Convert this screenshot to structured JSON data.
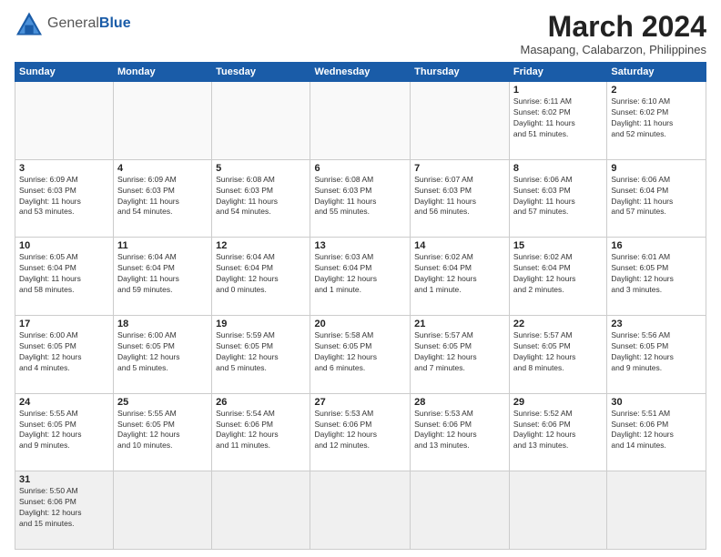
{
  "header": {
    "logo_general": "General",
    "logo_blue": "Blue",
    "month_title": "March 2024",
    "subtitle": "Masapang, Calabarzon, Philippines"
  },
  "weekdays": [
    "Sunday",
    "Monday",
    "Tuesday",
    "Wednesday",
    "Thursday",
    "Friday",
    "Saturday"
  ],
  "weeks": [
    [
      {
        "day": "",
        "info": ""
      },
      {
        "day": "",
        "info": ""
      },
      {
        "day": "",
        "info": ""
      },
      {
        "day": "",
        "info": ""
      },
      {
        "day": "",
        "info": ""
      },
      {
        "day": "1",
        "info": "Sunrise: 6:11 AM\nSunset: 6:02 PM\nDaylight: 11 hours\nand 51 minutes."
      },
      {
        "day": "2",
        "info": "Sunrise: 6:10 AM\nSunset: 6:02 PM\nDaylight: 11 hours\nand 52 minutes."
      }
    ],
    [
      {
        "day": "3",
        "info": "Sunrise: 6:09 AM\nSunset: 6:03 PM\nDaylight: 11 hours\nand 53 minutes."
      },
      {
        "day": "4",
        "info": "Sunrise: 6:09 AM\nSunset: 6:03 PM\nDaylight: 11 hours\nand 54 minutes."
      },
      {
        "day": "5",
        "info": "Sunrise: 6:08 AM\nSunset: 6:03 PM\nDaylight: 11 hours\nand 54 minutes."
      },
      {
        "day": "6",
        "info": "Sunrise: 6:08 AM\nSunset: 6:03 PM\nDaylight: 11 hours\nand 55 minutes."
      },
      {
        "day": "7",
        "info": "Sunrise: 6:07 AM\nSunset: 6:03 PM\nDaylight: 11 hours\nand 56 minutes."
      },
      {
        "day": "8",
        "info": "Sunrise: 6:06 AM\nSunset: 6:03 PM\nDaylight: 11 hours\nand 57 minutes."
      },
      {
        "day": "9",
        "info": "Sunrise: 6:06 AM\nSunset: 6:04 PM\nDaylight: 11 hours\nand 57 minutes."
      }
    ],
    [
      {
        "day": "10",
        "info": "Sunrise: 6:05 AM\nSunset: 6:04 PM\nDaylight: 11 hours\nand 58 minutes."
      },
      {
        "day": "11",
        "info": "Sunrise: 6:04 AM\nSunset: 6:04 PM\nDaylight: 11 hours\nand 59 minutes."
      },
      {
        "day": "12",
        "info": "Sunrise: 6:04 AM\nSunset: 6:04 PM\nDaylight: 12 hours\nand 0 minutes."
      },
      {
        "day": "13",
        "info": "Sunrise: 6:03 AM\nSunset: 6:04 PM\nDaylight: 12 hours\nand 1 minute."
      },
      {
        "day": "14",
        "info": "Sunrise: 6:02 AM\nSunset: 6:04 PM\nDaylight: 12 hours\nand 1 minute."
      },
      {
        "day": "15",
        "info": "Sunrise: 6:02 AM\nSunset: 6:04 PM\nDaylight: 12 hours\nand 2 minutes."
      },
      {
        "day": "16",
        "info": "Sunrise: 6:01 AM\nSunset: 6:05 PM\nDaylight: 12 hours\nand 3 minutes."
      }
    ],
    [
      {
        "day": "17",
        "info": "Sunrise: 6:00 AM\nSunset: 6:05 PM\nDaylight: 12 hours\nand 4 minutes."
      },
      {
        "day": "18",
        "info": "Sunrise: 6:00 AM\nSunset: 6:05 PM\nDaylight: 12 hours\nand 5 minutes."
      },
      {
        "day": "19",
        "info": "Sunrise: 5:59 AM\nSunset: 6:05 PM\nDaylight: 12 hours\nand 5 minutes."
      },
      {
        "day": "20",
        "info": "Sunrise: 5:58 AM\nSunset: 6:05 PM\nDaylight: 12 hours\nand 6 minutes."
      },
      {
        "day": "21",
        "info": "Sunrise: 5:57 AM\nSunset: 6:05 PM\nDaylight: 12 hours\nand 7 minutes."
      },
      {
        "day": "22",
        "info": "Sunrise: 5:57 AM\nSunset: 6:05 PM\nDaylight: 12 hours\nand 8 minutes."
      },
      {
        "day": "23",
        "info": "Sunrise: 5:56 AM\nSunset: 6:05 PM\nDaylight: 12 hours\nand 9 minutes."
      }
    ],
    [
      {
        "day": "24",
        "info": "Sunrise: 5:55 AM\nSunset: 6:05 PM\nDaylight: 12 hours\nand 9 minutes."
      },
      {
        "day": "25",
        "info": "Sunrise: 5:55 AM\nSunset: 6:05 PM\nDaylight: 12 hours\nand 10 minutes."
      },
      {
        "day": "26",
        "info": "Sunrise: 5:54 AM\nSunset: 6:06 PM\nDaylight: 12 hours\nand 11 minutes."
      },
      {
        "day": "27",
        "info": "Sunrise: 5:53 AM\nSunset: 6:06 PM\nDaylight: 12 hours\nand 12 minutes."
      },
      {
        "day": "28",
        "info": "Sunrise: 5:53 AM\nSunset: 6:06 PM\nDaylight: 12 hours\nand 13 minutes."
      },
      {
        "day": "29",
        "info": "Sunrise: 5:52 AM\nSunset: 6:06 PM\nDaylight: 12 hours\nand 13 minutes."
      },
      {
        "day": "30",
        "info": "Sunrise: 5:51 AM\nSunset: 6:06 PM\nDaylight: 12 hours\nand 14 minutes."
      }
    ],
    [
      {
        "day": "31",
        "info": "Sunrise: 5:50 AM\nSunset: 6:06 PM\nDaylight: 12 hours\nand 15 minutes."
      },
      {
        "day": "",
        "info": ""
      },
      {
        "day": "",
        "info": ""
      },
      {
        "day": "",
        "info": ""
      },
      {
        "day": "",
        "info": ""
      },
      {
        "day": "",
        "info": ""
      },
      {
        "day": "",
        "info": ""
      }
    ]
  ]
}
